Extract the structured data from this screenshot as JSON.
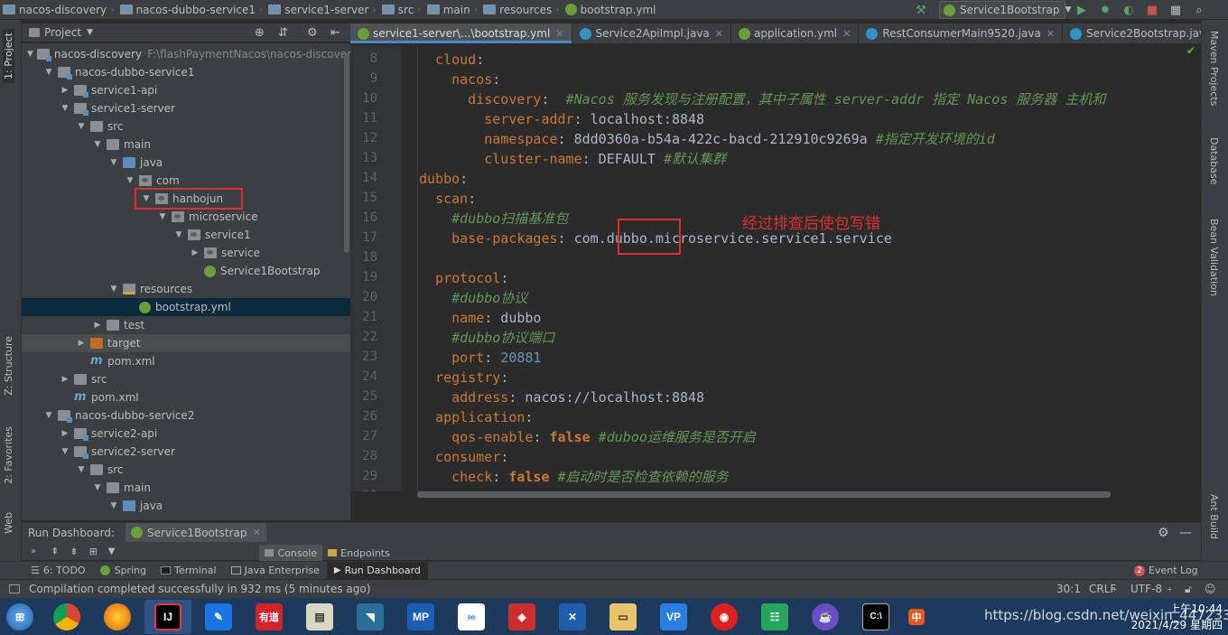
{
  "breadcrumbs": [
    "nacos-discovery",
    "nacos-dubbo-service1",
    "service1-server",
    "src",
    "main",
    "resources",
    "bootstrap.yml"
  ],
  "run_config": "Service1Bootstrap",
  "left_stripe": {
    "project": "1: Project",
    "structure": "Z: Structure",
    "favorites": "2: Favorites",
    "web": "Web"
  },
  "right_stripe": {
    "maven": "Maven Projects",
    "database": "Database",
    "bean": "Bean Validation",
    "ant": "Ant Build"
  },
  "project_panel": {
    "title": "Project"
  },
  "tree": [
    {
      "label": "nacos-discovery",
      "hint": "F:\\flashPaymentNacos\\nacos-discovery",
      "icon": "module-folder",
      "arrow": "down",
      "indent": 0
    },
    {
      "label": "nacos-dubbo-service1",
      "icon": "module-folder",
      "arrow": "down",
      "indent": 1
    },
    {
      "label": "service1-api",
      "icon": "module-folder",
      "arrow": "right",
      "indent": 2
    },
    {
      "label": "service1-server",
      "icon": "module-folder",
      "arrow": "down",
      "indent": 2
    },
    {
      "label": "src",
      "icon": "folder",
      "arrow": "down",
      "indent": 3
    },
    {
      "label": "main",
      "icon": "folder",
      "arrow": "down",
      "indent": 4
    },
    {
      "label": "java",
      "icon": "src-folder",
      "arrow": "down",
      "indent": 5
    },
    {
      "label": "com",
      "icon": "package",
      "arrow": "down",
      "indent": 6
    },
    {
      "label": "hanbojun",
      "icon": "package",
      "arrow": "down",
      "indent": 7
    },
    {
      "label": "microservice",
      "icon": "package",
      "arrow": "down",
      "indent": 8
    },
    {
      "label": "service1",
      "icon": "package",
      "arrow": "down",
      "indent": 9
    },
    {
      "label": "service",
      "icon": "package",
      "arrow": "right",
      "indent": 10
    },
    {
      "label": "Service1Bootstrap",
      "icon": "spring",
      "arrow": "none",
      "indent": 10
    },
    {
      "label": "resources",
      "icon": "resources-folder",
      "arrow": "down",
      "indent": 5
    },
    {
      "label": "bootstrap.yml",
      "icon": "yml",
      "arrow": "none",
      "indent": 6
    },
    {
      "label": "test",
      "icon": "folder",
      "arrow": "right",
      "indent": 4
    },
    {
      "label": "target",
      "icon": "target-folder",
      "arrow": "right",
      "indent": 3
    },
    {
      "label": "pom.xml",
      "icon": "maven",
      "arrow": "none",
      "indent": 3
    },
    {
      "label": "src",
      "icon": "folder",
      "arrow": "right",
      "indent": 2
    },
    {
      "label": "pom.xml",
      "icon": "maven",
      "arrow": "none",
      "indent": 2
    },
    {
      "label": "nacos-dubbo-service2",
      "icon": "module-folder",
      "arrow": "down",
      "indent": 1
    },
    {
      "label": "service2-api",
      "icon": "module-folder",
      "arrow": "right",
      "indent": 2
    },
    {
      "label": "service2-server",
      "icon": "module-folder",
      "arrow": "down",
      "indent": 2
    },
    {
      "label": "src",
      "icon": "folder",
      "arrow": "down",
      "indent": 3
    },
    {
      "label": "main",
      "icon": "folder",
      "arrow": "down",
      "indent": 4
    },
    {
      "label": "java",
      "icon": "src-folder",
      "arrow": "down",
      "indent": 5
    }
  ],
  "editor_tabs": [
    "service1-server\\...\\bootstrap.yml",
    "Service2ApiImpl.java",
    "application.yml",
    "RestConsumerMain9520.java",
    "Service2Bootstrap.java"
  ],
  "tabs_overflow": "⋯s",
  "code_lines": [
    {
      "n": "8",
      "parts": [
        [
          "k",
          "  cloud"
        ],
        [
          "v",
          ":"
        ]
      ]
    },
    {
      "n": "9",
      "parts": [
        [
          "k",
          "    nacos"
        ],
        [
          "v",
          ":"
        ]
      ]
    },
    {
      "n": "10",
      "parts": [
        [
          "k",
          "      discovery"
        ],
        [
          "v",
          ":  "
        ],
        [
          "c",
          "#Nacos 服务发现与注册配置，其中子属性 server-addr 指定 Nacos 服务器 主机和"
        ]
      ]
    },
    {
      "n": "11",
      "parts": [
        [
          "k",
          "        server-addr"
        ],
        [
          "v",
          ": localhost:8848"
        ]
      ]
    },
    {
      "n": "12",
      "parts": [
        [
          "k",
          "        namespace"
        ],
        [
          "v",
          ": 8dd0360a-b54a-422c-bacd-212910c9269a "
        ],
        [
          "c",
          "#指定开发环境的id"
        ]
      ]
    },
    {
      "n": "13",
      "parts": [
        [
          "k",
          "        cluster-name"
        ],
        [
          "v",
          ": DEFAULT "
        ],
        [
          "c",
          "#默认集群"
        ]
      ]
    },
    {
      "n": "14",
      "parts": [
        [
          "k",
          "dubbo"
        ],
        [
          "v",
          ":"
        ]
      ]
    },
    {
      "n": "15",
      "parts": [
        [
          "k",
          "  scan"
        ],
        [
          "v",
          ":"
        ]
      ]
    },
    {
      "n": "16",
      "parts": [
        [
          "c",
          "    #dubbo扫描基准包"
        ]
      ]
    },
    {
      "n": "17",
      "parts": [
        [
          "k",
          "    base-packages"
        ],
        [
          "v",
          ": com.dubbo.microservice.service1.service"
        ]
      ]
    },
    {
      "n": "18",
      "parts": []
    },
    {
      "n": "19",
      "parts": [
        [
          "k",
          "  protocol"
        ],
        [
          "v",
          ":"
        ]
      ]
    },
    {
      "n": "20",
      "parts": [
        [
          "c",
          "    #dubbo协议"
        ]
      ]
    },
    {
      "n": "21",
      "parts": [
        [
          "k",
          "    name"
        ],
        [
          "v",
          ": dubbo"
        ]
      ]
    },
    {
      "n": "22",
      "parts": [
        [
          "c",
          "    #dubbo协议端口"
        ]
      ]
    },
    {
      "n": "23",
      "parts": [
        [
          "k",
          "    port"
        ],
        [
          "v",
          ": "
        ],
        [
          "num",
          "20881"
        ]
      ]
    },
    {
      "n": "24",
      "parts": [
        [
          "k",
          "  registry"
        ],
        [
          "v",
          ":"
        ]
      ]
    },
    {
      "n": "25",
      "parts": [
        [
          "k",
          "    address"
        ],
        [
          "v",
          ": nacos://localhost:8848"
        ]
      ]
    },
    {
      "n": "26",
      "parts": [
        [
          "k",
          "  application"
        ],
        [
          "v",
          ":"
        ]
      ]
    },
    {
      "n": "27",
      "parts": [
        [
          "k",
          "    qos-enable"
        ],
        [
          "v",
          ": "
        ],
        [
          "kw",
          "false"
        ],
        [
          "c",
          " #duboo运维服务是否开启"
        ]
      ]
    },
    {
      "n": "28",
      "parts": [
        [
          "k",
          "  consumer"
        ],
        [
          "v",
          ":"
        ]
      ]
    },
    {
      "n": "29",
      "parts": [
        [
          "k",
          "    check"
        ],
        [
          "v",
          ": "
        ],
        [
          "kw",
          "false"
        ],
        [
          "c",
          " #启动时是否检查依赖的服务"
        ]
      ]
    },
    {
      "n": "30",
      "parts": []
    }
  ],
  "annotation": "经过排查后使包写错",
  "run_dashboard": {
    "title": "Run Dashboard:",
    "config": "Service1Bootstrap",
    "console": "Console",
    "endpoints": "Endpoints"
  },
  "bottom_tabs": [
    "6: TODO",
    "Spring",
    "Terminal",
    "Java Enterprise",
    "Run Dashboard"
  ],
  "event_log": {
    "count": "2",
    "label": "Event Log"
  },
  "status": {
    "message": "Compilation completed successfully in 932 ms (5 minutes ago)",
    "position": "30:1",
    "line_sep": "CRLF",
    "encoding": "UTF-8"
  },
  "taskbar": {
    "watermark": "https://blog.csdn.net/weixin_44723367",
    "time": "上午10:44",
    "date": "2021/4/29 星期四"
  },
  "colors": {
    "accent": "#4a88c7",
    "highlight_box": "#e0302c",
    "selected_row": "#0d293e"
  }
}
